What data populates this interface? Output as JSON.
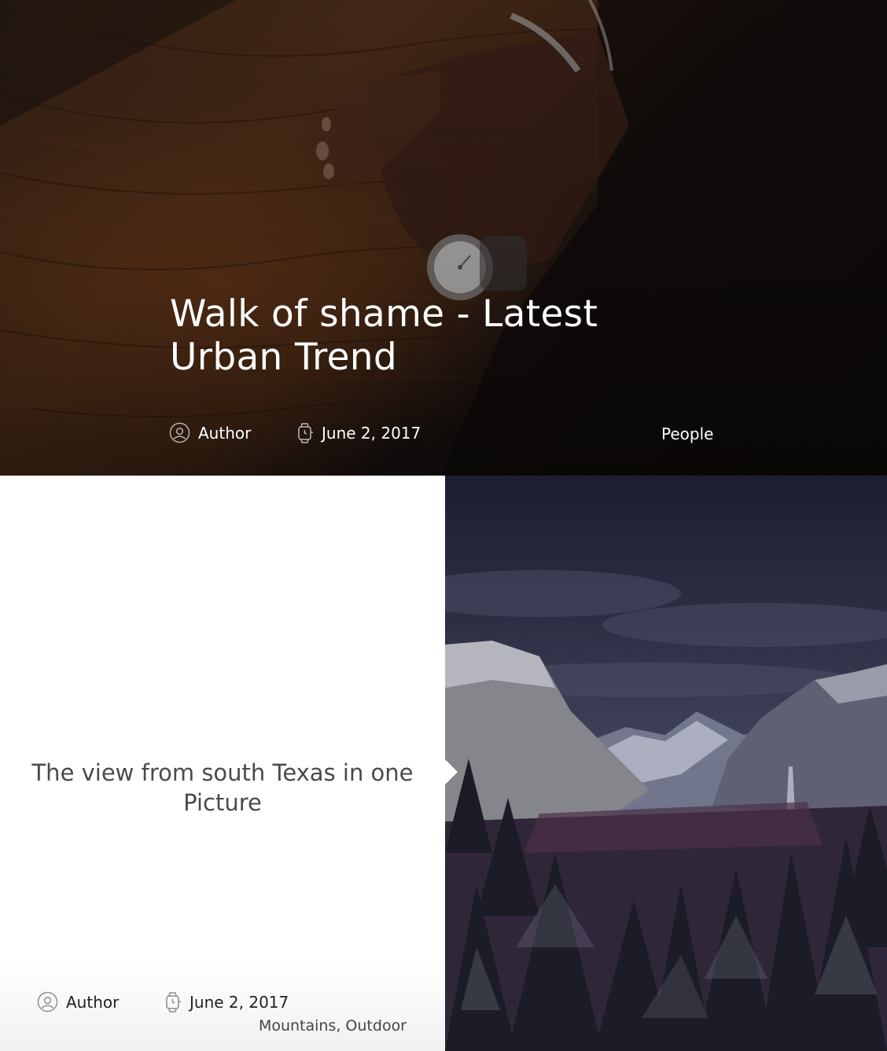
{
  "featured_post": {
    "title": "Walk of shame - Latest Urban Trend",
    "author": "Author",
    "date": "June 2, 2017",
    "category": "People",
    "image_icon": "hands-watch-table-photo"
  },
  "post_2": {
    "title": "The view from south Texas in one Picture",
    "author": "Author",
    "date": "June 2, 2017",
    "categories": "Mountains, Outdoor",
    "image_icon": "snowy-valley-photo"
  },
  "icons": {
    "author": "user-circle-icon",
    "date": "watch-icon"
  }
}
